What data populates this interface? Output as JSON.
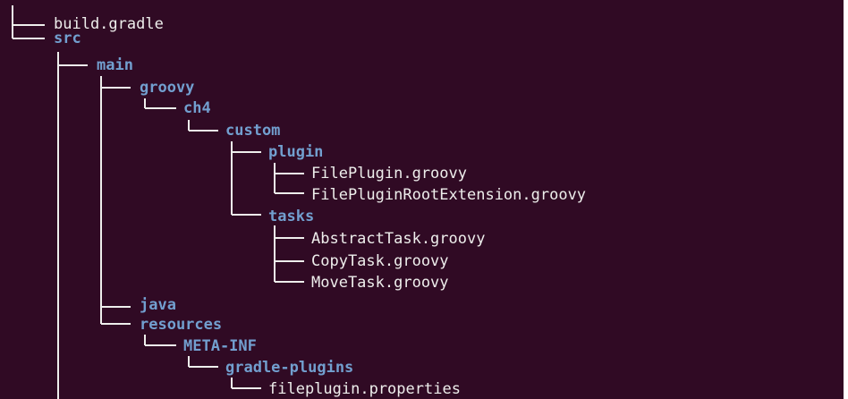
{
  "theme": {
    "background": "#300a24",
    "text": "#eeeeec",
    "directory": "#729fcf"
  },
  "tree": {
    "nodes": [
      {
        "name": "build.gradle",
        "type": "file"
      },
      {
        "name": "src",
        "type": "dir"
      },
      {
        "name": "main",
        "type": "dir"
      },
      {
        "name": "groovy",
        "type": "dir"
      },
      {
        "name": "ch4",
        "type": "dir"
      },
      {
        "name": "custom",
        "type": "dir"
      },
      {
        "name": "plugin",
        "type": "dir"
      },
      {
        "name": "FilePlugin.groovy",
        "type": "file"
      },
      {
        "name": "FilePluginRootExtension.groovy",
        "type": "file"
      },
      {
        "name": "tasks",
        "type": "dir"
      },
      {
        "name": "AbstractTask.groovy",
        "type": "file"
      },
      {
        "name": "CopyTask.groovy",
        "type": "file"
      },
      {
        "name": "MoveTask.groovy",
        "type": "file"
      },
      {
        "name": "java",
        "type": "dir"
      },
      {
        "name": "resources",
        "type": "dir"
      },
      {
        "name": "META-INF",
        "type": "dir"
      },
      {
        "name": "gradle-plugins",
        "type": "dir"
      },
      {
        "name": "fileplugin.properties",
        "type": "file"
      }
    ]
  }
}
